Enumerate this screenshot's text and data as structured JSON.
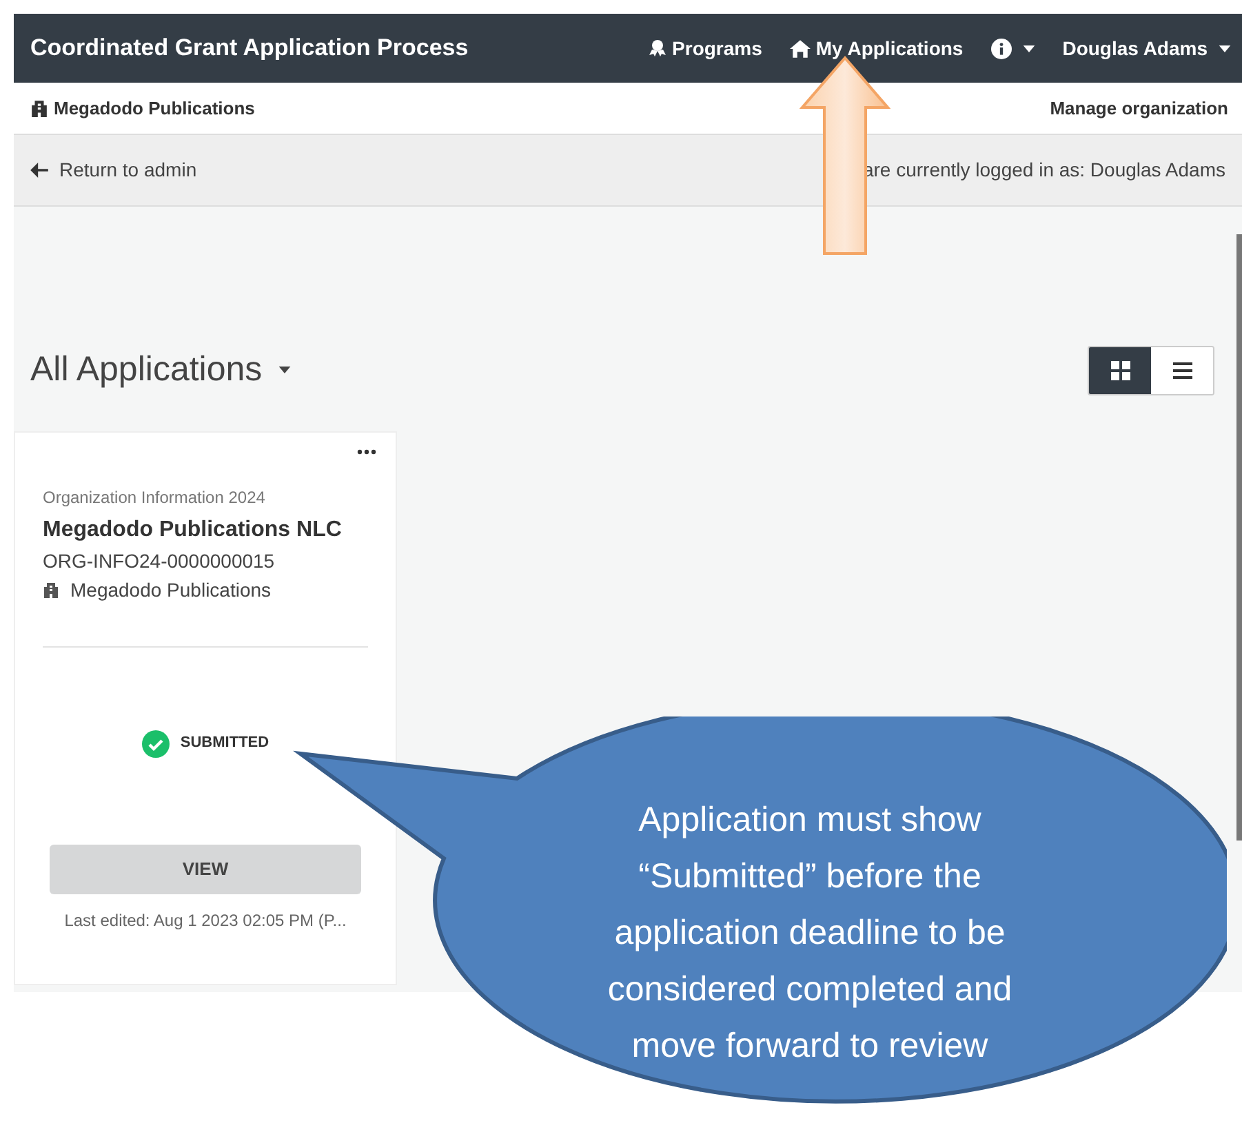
{
  "navbar": {
    "title": "Coordinated Grant Application Process",
    "items": [
      {
        "kind": "programs",
        "label": "Programs"
      },
      {
        "kind": "home",
        "label": "My Applications"
      },
      {
        "kind": "info"
      },
      {
        "kind": "user",
        "label": "Douglas Adams"
      }
    ]
  },
  "org_bar": {
    "organization": "Megadodo Publications",
    "manage": "Manage organization"
  },
  "admin_bar": {
    "return": "Return to admin",
    "logged_in": "are currently logged in as: Douglas Adams"
  },
  "heading": "All Applications",
  "view_toggle": [
    {
      "kind": "grid",
      "selected": true
    },
    {
      "kind": "list",
      "selected": false
    }
  ],
  "card": {
    "program": "Organization Information 2024",
    "title": "Megadodo Publications NLC",
    "id": "ORG-INFO24-0000000015",
    "organization": "Megadodo Publications",
    "status": "SUBMITTED",
    "button": "VIEW",
    "last_edited": "Last edited: Aug 1 2023 02:05 PM (P..."
  },
  "callout": {
    "lines": [
      "Application must show",
      "“Submitted” before the",
      "application deadline to be",
      "considered completed and",
      "move forward to review"
    ]
  }
}
